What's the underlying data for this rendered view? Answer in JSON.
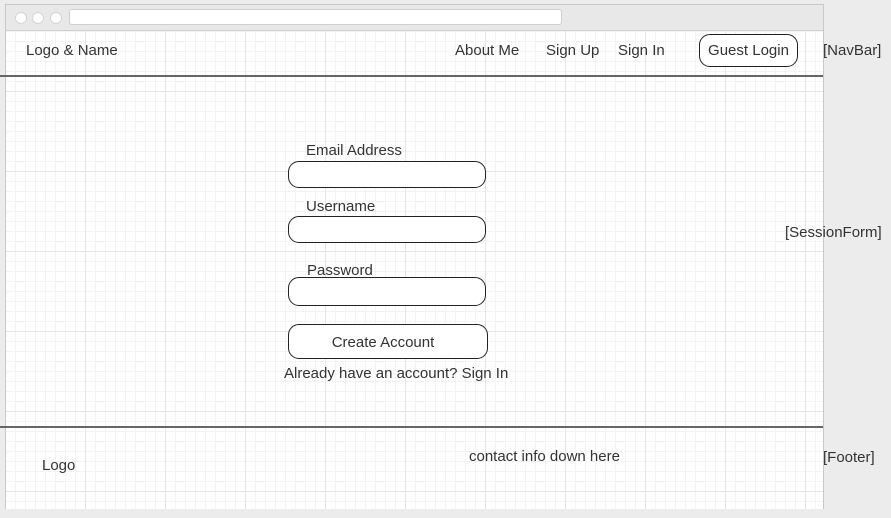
{
  "navbar": {
    "brand": "Logo & Name",
    "links": [
      "About Me",
      "Sign Up",
      "Sign In"
    ],
    "guest_login": "Guest Login",
    "annotation": "[NavBar]"
  },
  "form": {
    "email_label": "Email Address",
    "email_value": "",
    "username_label": "Username",
    "username_value": "",
    "password_label": "Password",
    "password_value": "",
    "submit_label": "Create Account",
    "signin_prompt": "Already have an account? Sign In",
    "annotation": "[SessionForm]"
  },
  "footer": {
    "logo": "Logo",
    "contact": "contact info down here",
    "annotation": "[Footer]"
  }
}
